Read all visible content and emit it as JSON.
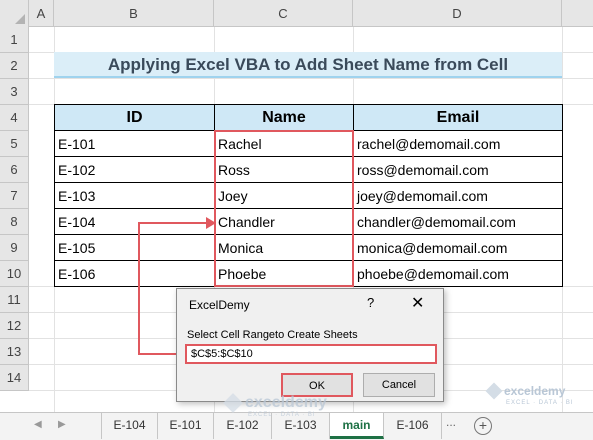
{
  "columns": [
    "A",
    "B",
    "C",
    "D"
  ],
  "rows": [
    "1",
    "2",
    "3",
    "4",
    "5",
    "6",
    "7",
    "8",
    "9",
    "10",
    "11",
    "12",
    "13",
    "14"
  ],
  "title": "Applying Excel VBA to Add Sheet Name from Cell",
  "table": {
    "headers": [
      "ID",
      "Name",
      "Email"
    ],
    "rows": [
      [
        "E-101",
        "Rachel",
        "rachel@demomail.com"
      ],
      [
        "E-102",
        "Ross",
        "ross@demomail.com"
      ],
      [
        "E-103",
        "Joey",
        "joey@demomail.com"
      ],
      [
        "E-104",
        "Chandler",
        "chandler@demomail.com"
      ],
      [
        "E-105",
        "Monica",
        "monica@demomail.com"
      ],
      [
        "E-106",
        "Phoebe",
        "phoebe@demomail.com"
      ]
    ]
  },
  "dialog": {
    "title": "ExcelDemy",
    "help": "?",
    "close": "✕",
    "prompt": "Select Cell Rangeto Create Sheets",
    "input_value": "$C$5:$C$10",
    "ok_label": "OK",
    "cancel_label": "Cancel"
  },
  "watermark": {
    "name": "exceldemy",
    "sub": "EXCEL · DATA · BI"
  },
  "tabs": {
    "prev": "◀",
    "next": "▶",
    "items": [
      "E-104",
      "E-101",
      "E-102",
      "E-103",
      "main",
      "E-106"
    ],
    "active": "main",
    "more": "...",
    "add": "+"
  },
  "colors": {
    "accent_red": "#e0585e",
    "header_fill": "#cfe8f6",
    "title_fill": "#dbeef8",
    "active_tab": "#1e7145"
  }
}
